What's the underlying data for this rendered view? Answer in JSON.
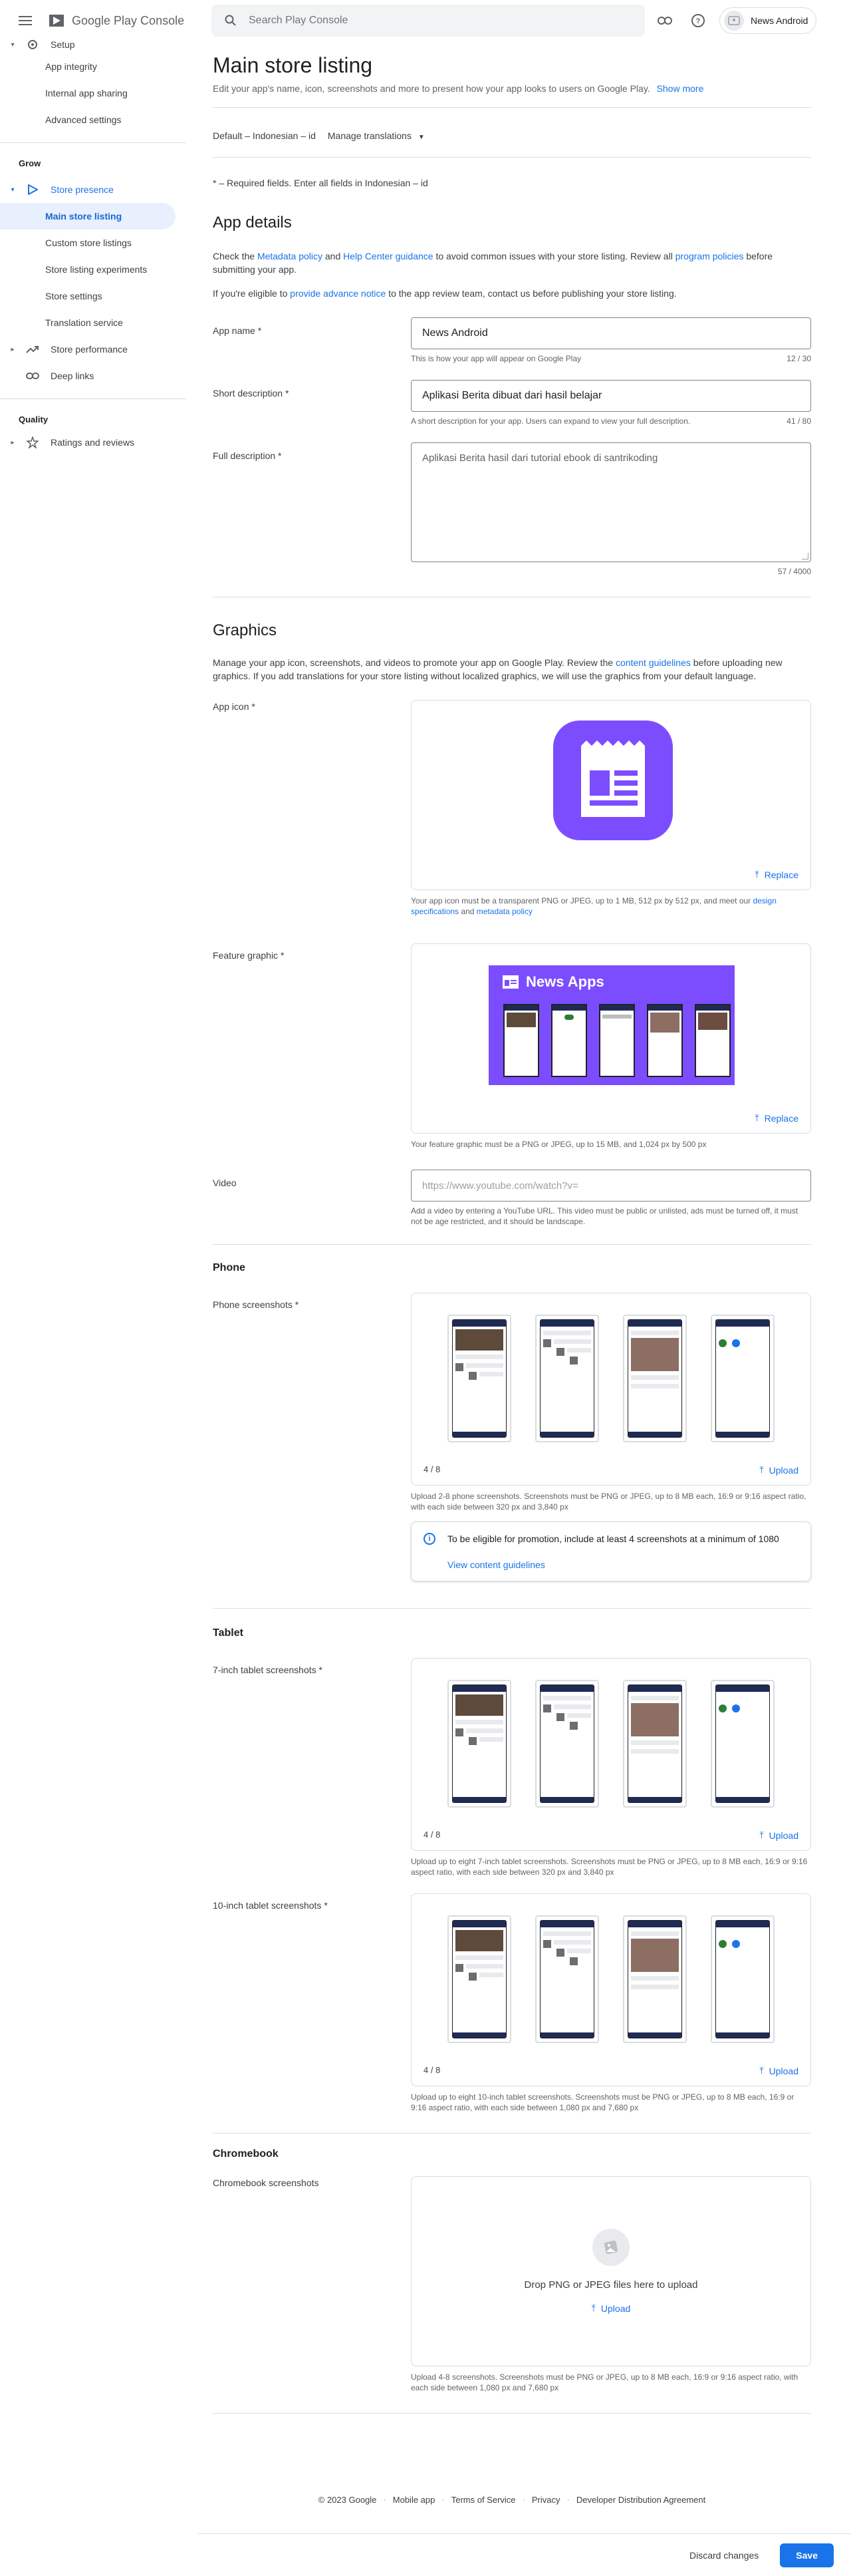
{
  "app": {
    "brand": "Google Play Console"
  },
  "search": {
    "placeholder": "Search Play Console"
  },
  "account": {
    "name": "News Android"
  },
  "nav": {
    "setup_label": "Setup",
    "setup_items": [
      "App integrity",
      "Internal app sharing",
      "Advanced settings"
    ],
    "grow_header": "Grow",
    "store_presence": "Store presence",
    "store_presence_items": [
      "Main store listing",
      "Custom store listings",
      "Store listing experiments",
      "Store settings",
      "Translation service"
    ],
    "store_performance": "Store performance",
    "deep_links": "Deep links",
    "quality_header": "Quality",
    "ratings": "Ratings and reviews"
  },
  "page": {
    "title": "Main store listing",
    "subtitle": "Edit your app's name, icon, screenshots and more to present how your app looks to users on Google Play.",
    "show_more": "Show more",
    "language": "Default – Indonesian – id",
    "manage_translations": "Manage translations",
    "required_note": "* – Required fields. Enter all fields in Indonesian – id"
  },
  "app_details": {
    "heading": "App details",
    "intro_1": "Check the",
    "metadata_policy": "Metadata policy",
    "and": "and",
    "help_center": "Help Center guidance",
    "intro_2": "to avoid common issues with your store listing. Review all",
    "program_policies": "program policies",
    "intro_3": "before submitting your app.",
    "advance_1": "If you're eligible to",
    "advance_link": "provide advance notice",
    "advance_2": "to the app review team, contact us before publishing your store listing.",
    "app_name_label": "App name",
    "app_name_value": "News Android",
    "app_name_hint": "This is how your app will appear on Google Play",
    "app_name_count": "12 / 30",
    "short_label": "Short description",
    "short_value": "Aplikasi Berita dibuat dari hasil belajar",
    "short_hint": "A short description for your app. Users can expand to view your full description.",
    "short_count": "41 / 80",
    "full_label": "Full description",
    "full_value": "Aplikasi Berita hasil dari tutorial ebook di santrikoding",
    "full_count": "57 / 4000",
    "required_star": "*"
  },
  "graphics": {
    "heading": "Graphics",
    "intro_1": "Manage your app icon, screenshots, and videos to promote your app on Google Play. Review the",
    "content_guidelines": "content guidelines",
    "intro_2": "before uploading new graphics. If you add translations for your store listing without localized graphics, we will use the graphics from your default language.",
    "app_icon_label": "App icon",
    "replace": "Replace",
    "icon_hint_1": "Your app icon must be a transparent PNG or JPEG, up to 1 MB, 512 px by 512 px, and meet our",
    "design_specs": "design specifications",
    "icon_hint_and": "and",
    "metadata_policy": "metadata policy",
    "feature_label": "Feature graphic",
    "feature_title": "News Apps",
    "feature_hint": "Your feature graphic must be a PNG or JPEG, up to 15 MB, and 1,024 px by 500 px",
    "video_label": "Video",
    "video_placeholder": "https://www.youtube.com/watch?v=",
    "video_hint": "Add a video by entering a YouTube URL. This video must be public or unlisted, ads must be turned off, it must not be age restricted, and it should be landscape.",
    "brand_color": "#7c4dff"
  },
  "phone": {
    "heading": "Phone",
    "label": "Phone screenshots",
    "count": "4 / 8",
    "upload": "Upload",
    "hint": "Upload 2-8 phone screenshots. Screenshots must be PNG or JPEG, up to 8 MB each, 16:9 or 9:16 aspect ratio, with each side between 320 px and 3,840 px",
    "promo_text": "To be eligible for promotion, include at least 4 screenshots at a minimum of 1080",
    "promo_link": "View content guidelines"
  },
  "tablet": {
    "heading": "Tablet",
    "seven_label": "7-inch tablet screenshots",
    "seven_count": "4 / 8",
    "seven_hint": "Upload up to eight 7-inch tablet screenshots. Screenshots must be PNG or JPEG, up to 8 MB each, 16:9 or 9:16 aspect ratio, with each side between 320 px and 3,840 px",
    "ten_label": "10-inch tablet screenshots",
    "ten_count": "4 / 8",
    "ten_hint": "Upload up to eight 10-inch tablet screenshots. Screenshots must be PNG or JPEG, up to 8 MB each, 16:9 or 9:16 aspect ratio, with each side between 1,080 px and 7,680 px",
    "upload": "Upload"
  },
  "chromebook": {
    "heading": "Chromebook",
    "label": "Chromebook screenshots",
    "drop_text": "Drop PNG or JPEG files here to upload",
    "upload": "Upload",
    "hint": "Upload 4-8 screenshots. Screenshots must be PNG or JPEG, up to 8 MB each, 16:9 or 9:16 aspect ratio, with each side between 1,080 px and 7,680 px"
  },
  "footer": {
    "copyright": "© 2023 Google",
    "links": [
      "Mobile app",
      "Terms of Service",
      "Privacy",
      "Developer Distribution Agreement"
    ]
  },
  "actions": {
    "discard": "Discard changes",
    "save": "Save"
  }
}
